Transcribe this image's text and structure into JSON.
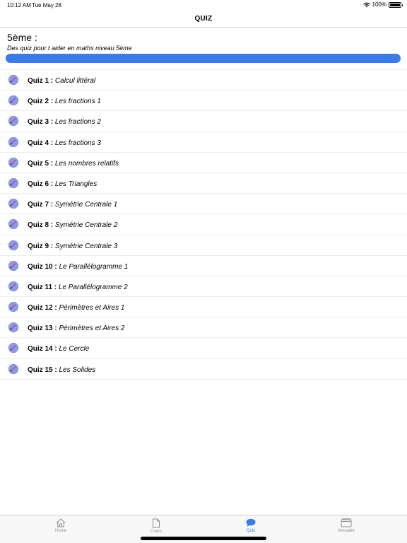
{
  "status": {
    "time": "10:12 AM",
    "date": "Tue May 28",
    "battery": "100%"
  },
  "nav": {
    "title": "QUIZ"
  },
  "header": {
    "level": "5ème :",
    "subtitle": "Des quiz pour t aider en maths niveau 5ème",
    "progress": 1.0
  },
  "quizzes": [
    {
      "label": "Quiz 1 :",
      "title": "Calcul littéral"
    },
    {
      "label": "Quiz 2 :",
      "title": "Les fractions 1"
    },
    {
      "label": "Quiz 3 :",
      "title": "Les fractions 2"
    },
    {
      "label": "Quiz 4 :",
      "title": "Les fractions 3"
    },
    {
      "label": "Quiz 5 :",
      "title": "Les nombres relatifs"
    },
    {
      "label": "Quiz 6 :",
      "title": "Les Triangles"
    },
    {
      "label": "Quiz 7 :",
      "title": "Symétrie Centrale 1"
    },
    {
      "label": "Quiz 8 :",
      "title": "Symétrie Centrale 2"
    },
    {
      "label": "Quiz 9 :",
      "title": "Symétrie Centrale 3"
    },
    {
      "label": "Quiz 10 :",
      "title": "Le Parallélogramme 1"
    },
    {
      "label": "Quiz 11 :",
      "title": "Le Parallélogramme 2"
    },
    {
      "label": "Quiz 12 :",
      "title": "Périmètres et Aires 1"
    },
    {
      "label": "Quiz 13 :",
      "title": "Périmètres et Aires 2"
    },
    {
      "label": "Quiz 14 :",
      "title": "Le Cercle"
    },
    {
      "label": "Quiz 15 :",
      "title": "Les Solides"
    }
  ],
  "tabs": {
    "home": "Home",
    "cours": "Cours",
    "quiz": "Quiz",
    "annuaire": "Annuaire"
  },
  "colors": {
    "accent": "#3b7be8",
    "tab_inactive": "#8e8e93",
    "quiz_icon": "#8a9be6"
  }
}
